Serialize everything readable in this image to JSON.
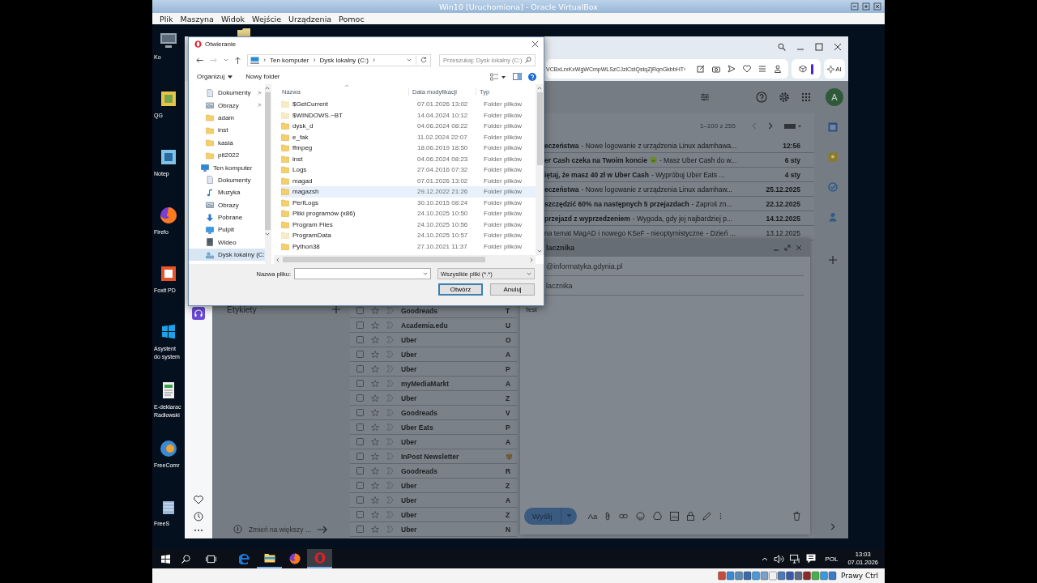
{
  "vbox": {
    "title": "Win10 [Uruchomiona] - Oracle VirtualBox",
    "menu": [
      "Plik",
      "Maszyna",
      "Widok",
      "Wejście",
      "Urządzenia",
      "Pomoc"
    ],
    "host_key": "Prawy Ctrl"
  },
  "desktop_icons": [
    {
      "kind": "computer",
      "lines": [
        "Ko"
      ]
    },
    {
      "kind": "qgis",
      "lines": [
        "QG"
      ]
    },
    {
      "kind": "notepad",
      "lines": [
        "Notep"
      ]
    },
    {
      "kind": "firefox",
      "lines": [
        "Firefo"
      ]
    },
    {
      "kind": "foxit",
      "lines": [
        "Foxit PD"
      ]
    },
    {
      "kind": "assistant",
      "lines": [
        "Asystent",
        "do system"
      ]
    },
    {
      "kind": "document",
      "lines": [
        "E-deklarac",
        "Radłowski"
      ]
    },
    {
      "kind": "freecommander",
      "lines": [
        "FreeComr"
      ]
    },
    {
      "kind": "database",
      "lines": [
        "FreeS"
      ]
    }
  ],
  "browser": {
    "url": "VCBxLrxKxWgWCmpWLSzCJzlCstQstqZjRqnGkbbHT›",
    "ai_label": "AI"
  },
  "gmail": {
    "avatar": "A",
    "pagination": "1–100 z 255",
    "labels_heading": "Etykiety",
    "storage_hint": "Zmień na większy ...",
    "top_messages": [
      {
        "kind": "plain",
        "subject": "eczeństwa",
        "snippet": "- Nowe logowanie z urządzenia Linux adamhawa...",
        "date": "12:56",
        "unread": true
      },
      {
        "kind": "emoji",
        "subject": "er Cash czeka na Twoim koncie",
        "snippet": "- Masz Uber Cash do w...",
        "date": "6 sty",
        "unread": true
      },
      {
        "kind": "plain",
        "subject": "iętaj, że masz 40 zł w Uber Cash",
        "snippet": "- Wypróbuj Uber Eats      ...",
        "date": "4 sty",
        "unread": true
      },
      {
        "kind": "plain",
        "subject": "eczeństwa",
        "snippet": "- Nowe logowanie z urządzenia Linux adamhaw...",
        "date": "25.12.2025",
        "unread": true
      },
      {
        "kind": "plain",
        "subject": "szczędzić 60% na następnych 5 przejazdach",
        "snippet": "- Zaproś zn...",
        "date": "22.12.2025",
        "unread": true
      },
      {
        "kind": "plain",
        "subject": "przejazd z wyprzedzeniem",
        "snippet": "- Wygoda, gdy jej najbardziej p...",
        "date": "14.12.2025",
        "unread": true
      },
      {
        "kind": "plain",
        "subject": "na temat MagAD i nowego KSeF - nieoptymistyczne",
        "snippet": "- Dzień ...",
        "date": "13.12.2025",
        "unread": false
      }
    ],
    "messages": [
      {
        "kind": "text",
        "sender": "Goodreads",
        "subject": "T",
        "checked": false,
        "starred": false
      },
      {
        "kind": "text",
        "sender": "Academia.edu",
        "subject": "U",
        "checked": false,
        "starred": false
      },
      {
        "kind": "text",
        "sender": "Uber",
        "subject": "O",
        "checked": false,
        "starred": false
      },
      {
        "kind": "text",
        "sender": "Uber",
        "subject": "A",
        "checked": false,
        "starred": false
      },
      {
        "kind": "text",
        "sender": "Uber",
        "subject": "P",
        "checked": false,
        "starred": false
      },
      {
        "kind": "text",
        "sender": "myMediaMarkt",
        "subject": "A",
        "checked": false,
        "starred": false
      },
      {
        "kind": "text",
        "sender": "Uber",
        "subject": "Z",
        "checked": false,
        "starred": false
      },
      {
        "kind": "text",
        "sender": "Goodreads",
        "subject": "V",
        "checked": false,
        "starred": false
      },
      {
        "kind": "text",
        "sender": "Uber Eats",
        "subject": "P",
        "checked": false,
        "starred": false
      },
      {
        "kind": "text",
        "sender": "Uber",
        "subject": "A",
        "checked": false,
        "starred": false
      },
      {
        "kind": "package",
        "sender": "InPost Newsletter",
        "checked": false,
        "starred": false
      },
      {
        "kind": "text",
        "sender": "Goodreads",
        "subject": "R",
        "checked": false,
        "starred": false
      },
      {
        "kind": "text",
        "sender": "Uber",
        "subject": "Z",
        "checked": false,
        "starred": false
      },
      {
        "kind": "text",
        "sender": "Uber",
        "subject": "A",
        "checked": false,
        "starred": false
      },
      {
        "kind": "text",
        "sender": "Uber",
        "subject": "Z",
        "checked": false,
        "starred": false
      },
      {
        "kind": "text",
        "sender": "Uber",
        "subject": "N",
        "checked": false,
        "starred": false
      }
    ],
    "compose": {
      "title": "lacznika",
      "to": "@informatyka.gdynia.pl",
      "subject": "lacznika",
      "body": "Test",
      "send": "Wyślij",
      "format": "Aa"
    }
  },
  "dialog": {
    "title": "Otwieranie",
    "breadcrumb": [
      {
        "kind": "separator",
        "text": "›"
      },
      {
        "kind": "crumb",
        "text": "Ten komputer"
      },
      {
        "kind": "separator",
        "text": "›"
      },
      {
        "kind": "crumb",
        "text": "Dysk lokalny (C:)"
      },
      {
        "kind": "separator",
        "text": "›"
      }
    ],
    "search_placeholder": "Przeszukaj: Dysk lokalny (C:)",
    "organize": "Organizuj",
    "new_folder": "Nowy folder",
    "nav": [
      {
        "label": "Dokumenty",
        "kind": "documents",
        "pinned": true,
        "selected": false
      },
      {
        "label": "Obrazy",
        "kind": "pictures",
        "pinned": true,
        "selected": false
      },
      {
        "label": "adam",
        "kind": "folder",
        "pinned": false,
        "selected": false
      },
      {
        "label": "inst",
        "kind": "folder",
        "pinned": false,
        "selected": false
      },
      {
        "label": "kasia",
        "kind": "folder",
        "pinned": false,
        "selected": false
      },
      {
        "label": "pit2022",
        "kind": "folder",
        "pinned": false,
        "selected": false
      },
      {
        "label": "Ten komputer",
        "kind": "computer",
        "selected": false,
        "children": [
          {
            "label": "Dokumenty",
            "kind": "documents",
            "selected": false
          },
          {
            "label": "Muzyka",
            "kind": "music",
            "selected": false
          },
          {
            "label": "Obrazy",
            "kind": "pictures",
            "selected": false
          },
          {
            "label": "Pobrane",
            "kind": "downloads",
            "selected": false
          },
          {
            "label": "Pulpit",
            "kind": "desktop",
            "selected": false
          },
          {
            "label": "Wideo",
            "kind": "video",
            "selected": false
          },
          {
            "label": "Dysk lokalny (C:",
            "kind": "drive",
            "selected": true
          }
        ]
      }
    ],
    "columns": [
      "Nazwa",
      "Data modyfikacji",
      "Typ"
    ],
    "files": [
      {
        "name": "$GetCurrent",
        "modified": "07.01.2026 13:02",
        "type": "Folder plików",
        "hidden": true,
        "hovered": false
      },
      {
        "name": "$WINDOWS.~BT",
        "modified": "14.04.2024 10:12",
        "type": "Folder plików",
        "hidden": true,
        "hovered": false
      },
      {
        "name": "dysk_d",
        "modified": "04.06.2024 08:22",
        "type": "Folder plików",
        "hidden": false,
        "hovered": false
      },
      {
        "name": "e_fak",
        "modified": "11.02.2024 22:07",
        "type": "Folder plików",
        "hidden": false,
        "hovered": false
      },
      {
        "name": "ffmpeg",
        "modified": "18.06.2019 18:50",
        "type": "Folder plików",
        "hidden": false,
        "hovered": false
      },
      {
        "name": "inst",
        "modified": "04.06.2024 08:23",
        "type": "Folder plików",
        "hidden": false,
        "hovered": false
      },
      {
        "name": "Logs",
        "modified": "27.04.2016 07:32",
        "type": "Folder plików",
        "hidden": false,
        "hovered": false
      },
      {
        "name": "magad",
        "modified": "07.01.2026 13:02",
        "type": "Folder plików",
        "hidden": false,
        "hovered": false
      },
      {
        "name": "magazsh",
        "modified": "29.12.2022 21:26",
        "type": "Folder plików",
        "hidden": false,
        "hovered": true
      },
      {
        "name": "PerfLogs",
        "modified": "30.10.2015 08:24",
        "type": "Folder plików",
        "hidden": false,
        "hovered": false
      },
      {
        "name": "Pliki programów (x86)",
        "modified": "24.10.2025 10:50",
        "type": "Folder plików",
        "hidden": false,
        "hovered": false
      },
      {
        "name": "Program Files",
        "modified": "24.10.2025 10:56",
        "type": "Folder plików",
        "hidden": false,
        "hovered": false
      },
      {
        "name": "ProgramData",
        "modified": "24.10.2025 10:57",
        "type": "Folder plików",
        "hidden": true,
        "hovered": false
      },
      {
        "name": "Python38",
        "modified": "27.10.2021 11:37",
        "type": "Folder plików",
        "hidden": false,
        "hovered": false
      }
    ],
    "filename_label": "Nazwa pliku:",
    "filter": "Wszystkie pliki (*.*)",
    "buttons": [
      {
        "label": "Otwórz",
        "default": true
      },
      {
        "label": "Anuluj",
        "default": false
      }
    ]
  },
  "taskbar": {
    "apps": [
      {
        "kind": "edge",
        "running": false,
        "active": false
      },
      {
        "kind": "explorer",
        "running": true,
        "active": false
      },
      {
        "kind": "firefox",
        "running": false,
        "active": false
      },
      {
        "kind": "opera",
        "running": true,
        "active": true
      }
    ],
    "language": "POL",
    "time": "13:03",
    "date": "07.01.2026"
  }
}
